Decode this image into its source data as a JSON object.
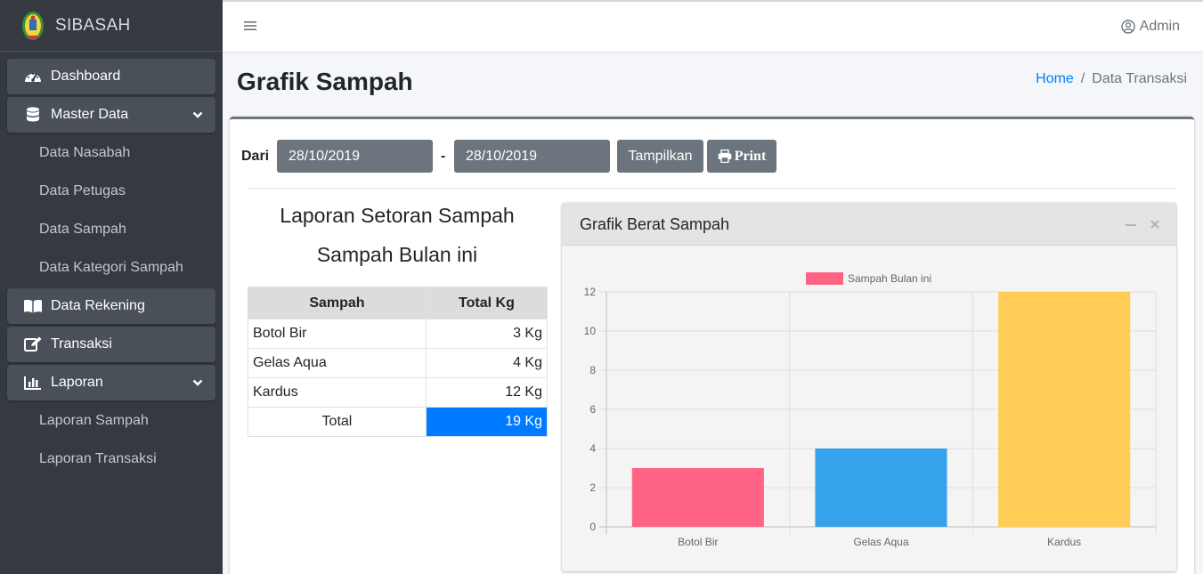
{
  "brand": {
    "name": "SIBASAH"
  },
  "sidebar": {
    "items": [
      {
        "label": "Dashboard",
        "icon": "tachometer-icon",
        "type": "main"
      },
      {
        "label": "Master Data",
        "icon": "database-icon",
        "type": "main",
        "expanded": true
      },
      {
        "label": "Data Nasabah",
        "type": "sub"
      },
      {
        "label": "Data Petugas",
        "type": "sub"
      },
      {
        "label": "Data Sampah",
        "type": "sub"
      },
      {
        "label": "Data Kategori Sampah",
        "type": "sub"
      },
      {
        "label": "Data Rekening",
        "icon": "book-icon",
        "type": "main"
      },
      {
        "label": "Transaksi",
        "icon": "edit-icon",
        "type": "main"
      },
      {
        "label": "Laporan",
        "icon": "chart-bar-icon",
        "type": "main",
        "expanded": true
      },
      {
        "label": "Laporan Sampah",
        "type": "sub"
      },
      {
        "label": "Laporan Transaksi",
        "type": "sub"
      }
    ]
  },
  "topbar": {
    "user": "Admin"
  },
  "header": {
    "title": "Grafik Sampah",
    "breadcrumb": {
      "home": "Home",
      "separator": "/",
      "current": "Data Transaksi"
    }
  },
  "filter": {
    "from_label": "Dari",
    "from_value": "28/10/2019",
    "separator": "-",
    "to_value": "28/10/2019",
    "show_button": "Tampilkan",
    "print_button": "Print"
  },
  "report": {
    "title": "Laporan Setoran Sampah",
    "subtitle": "Sampah Bulan ini",
    "columns": [
      "Sampah",
      "Total Kg"
    ],
    "rows": [
      {
        "name": "Botol Bir",
        "kg": "3 Kg"
      },
      {
        "name": "Gelas Aqua",
        "kg": "4 Kg"
      },
      {
        "name": "Kardus",
        "kg": "12 Kg"
      }
    ],
    "total_label": "Total",
    "total_value": "19 Kg"
  },
  "chart_card": {
    "title": "Grafik Berat Sampah"
  },
  "colors": {
    "accent": "#007bff",
    "sidebar": "#343a40",
    "button": "#6c757d"
  },
  "chart_data": {
    "type": "bar",
    "categories": [
      "Botol Bir",
      "Gelas Aqua",
      "Kardus"
    ],
    "series": [
      {
        "name": "Sampah Bulan ini",
        "values": [
          3,
          4,
          12
        ]
      }
    ],
    "bar_colors": [
      "#ff6384",
      "#36a2eb",
      "#ffcd56"
    ],
    "legend_color": "#ff6384",
    "ylim": [
      0,
      12
    ],
    "yticks": [
      0,
      2,
      4,
      6,
      8,
      10,
      12
    ],
    "grid": true,
    "legend_position": "top"
  }
}
